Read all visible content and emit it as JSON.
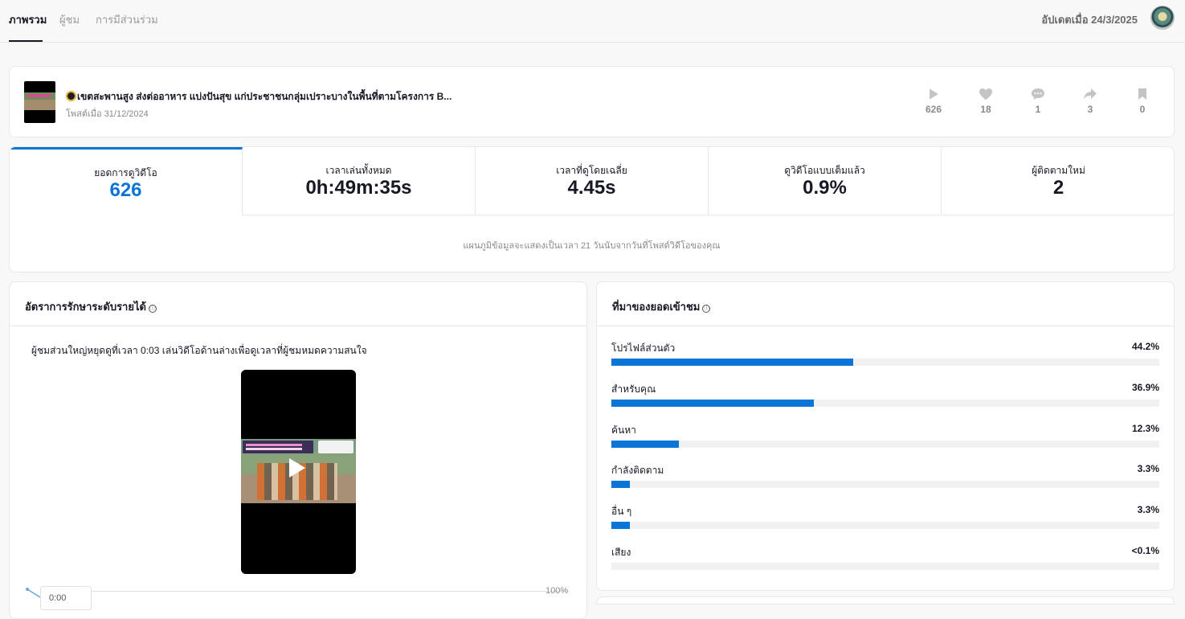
{
  "tabs": [
    {
      "label": "ภาพรวม",
      "active": true
    },
    {
      "label": "ผู้ชม",
      "active": false
    },
    {
      "label": "การมีส่วนร่วม",
      "active": false
    }
  ],
  "updated_text": "อัปเดตเมื่อ 24/3/2025",
  "post": {
    "title": "เขตสะพานสูง ส่งต่ออาหาร แบ่งปันสุข แก่ประชาชนกลุ่มเปราะบางในพื้นที่ตามโครงการ B...",
    "date": "โพสต์เมื่อ 31/12/2024",
    "metrics": [
      {
        "icon": "play-icon",
        "value": "626"
      },
      {
        "icon": "heart-icon",
        "value": "18"
      },
      {
        "icon": "comment-icon",
        "value": "1"
      },
      {
        "icon": "share-icon",
        "value": "3"
      },
      {
        "icon": "bookmark-icon",
        "value": "0"
      }
    ]
  },
  "stats": [
    {
      "label": "ยอดการดูวิดีโอ",
      "value": "626"
    },
    {
      "label": "เวลาเล่นทั้งหมด",
      "value": "0h:49m:35s"
    },
    {
      "label": "เวลาที่ดูโดยเฉลี่ย",
      "value": "4.45s"
    },
    {
      "label": "ดูวิดีโอแบบเต็มแล้ว",
      "value": "0.9%"
    },
    {
      "label": "ผู้ติดตามใหม่",
      "value": "2"
    }
  ],
  "stats_note": "แผนภูมิข้อมูลจะแสดงเป็นเวลา 21 วันนับจากวันที่โพสต์วิดีโอของคุณ",
  "retention": {
    "title": "อัตราการรักษาระดับรายได้",
    "info_icon": "ⓘ",
    "note": "ผู้ชมส่วนใหญ่หยุดดูที่เวลา 0:03 เล่นวิดีโอด้านล่างเพื่อดูเวลาที่ผู้ชมหมดความสนใจ",
    "axis_max_label": "100%",
    "time_label": "0:00"
  },
  "traffic": {
    "title": "ที่มาของยอดเข้าชม",
    "info_icon": "ⓘ",
    "sources": [
      {
        "label": "โปรไฟล์ส่วนตัว",
        "percent_text": "44.2%",
        "percent": 44.2
      },
      {
        "label": "สำหรับคุณ",
        "percent_text": "36.9%",
        "percent": 36.9
      },
      {
        "label": "ค้นหา",
        "percent_text": "12.3%",
        "percent": 12.3
      },
      {
        "label": "กำลังติดตาม",
        "percent_text": "3.3%",
        "percent": 3.3
      },
      {
        "label": "อื่น ๆ",
        "percent_text": "3.3%",
        "percent": 3.3
      },
      {
        "label": "เสียง",
        "percent_text": "<0.1%",
        "percent": 0.05
      }
    ]
  },
  "colors": {
    "accent": "#0a75d6",
    "icon_gray": "#c4c4c4"
  }
}
